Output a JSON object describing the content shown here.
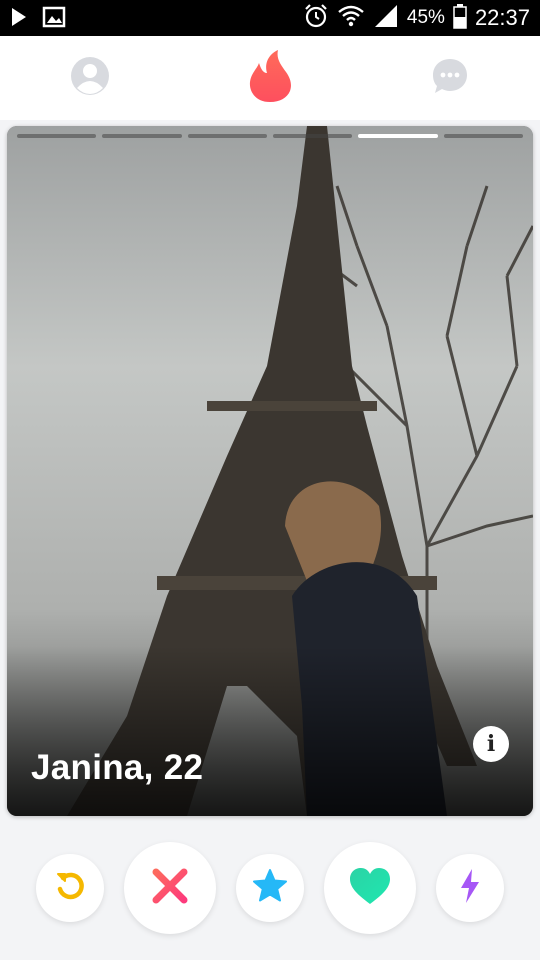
{
  "status_bar": {
    "battery": "45%",
    "time": "22:37",
    "icons": [
      "play-icon",
      "image-icon",
      "alarm-icon",
      "wifi-icon",
      "signal-icon",
      "battery-icon"
    ]
  },
  "nav": {
    "icons": [
      "profile-icon",
      "tinder-flame-icon",
      "chat-icon"
    ],
    "active": "tinder-flame-icon",
    "accent": "#fe5a53"
  },
  "profile_card": {
    "name_age": "Janina, 22",
    "photo_count": 6,
    "active_photo": 5,
    "info_label": "i"
  },
  "actions": [
    {
      "icon": "undo-icon",
      "color": "#f5b800"
    },
    {
      "icon": "nope-icon",
      "color": "#fd4b6a"
    },
    {
      "icon": "super-like-star-icon",
      "color": "#25b8f7"
    },
    {
      "icon": "like-heart-icon",
      "color": "#27e0a9"
    },
    {
      "icon": "boost-lightning-icon",
      "color": "#a657f6"
    }
  ]
}
